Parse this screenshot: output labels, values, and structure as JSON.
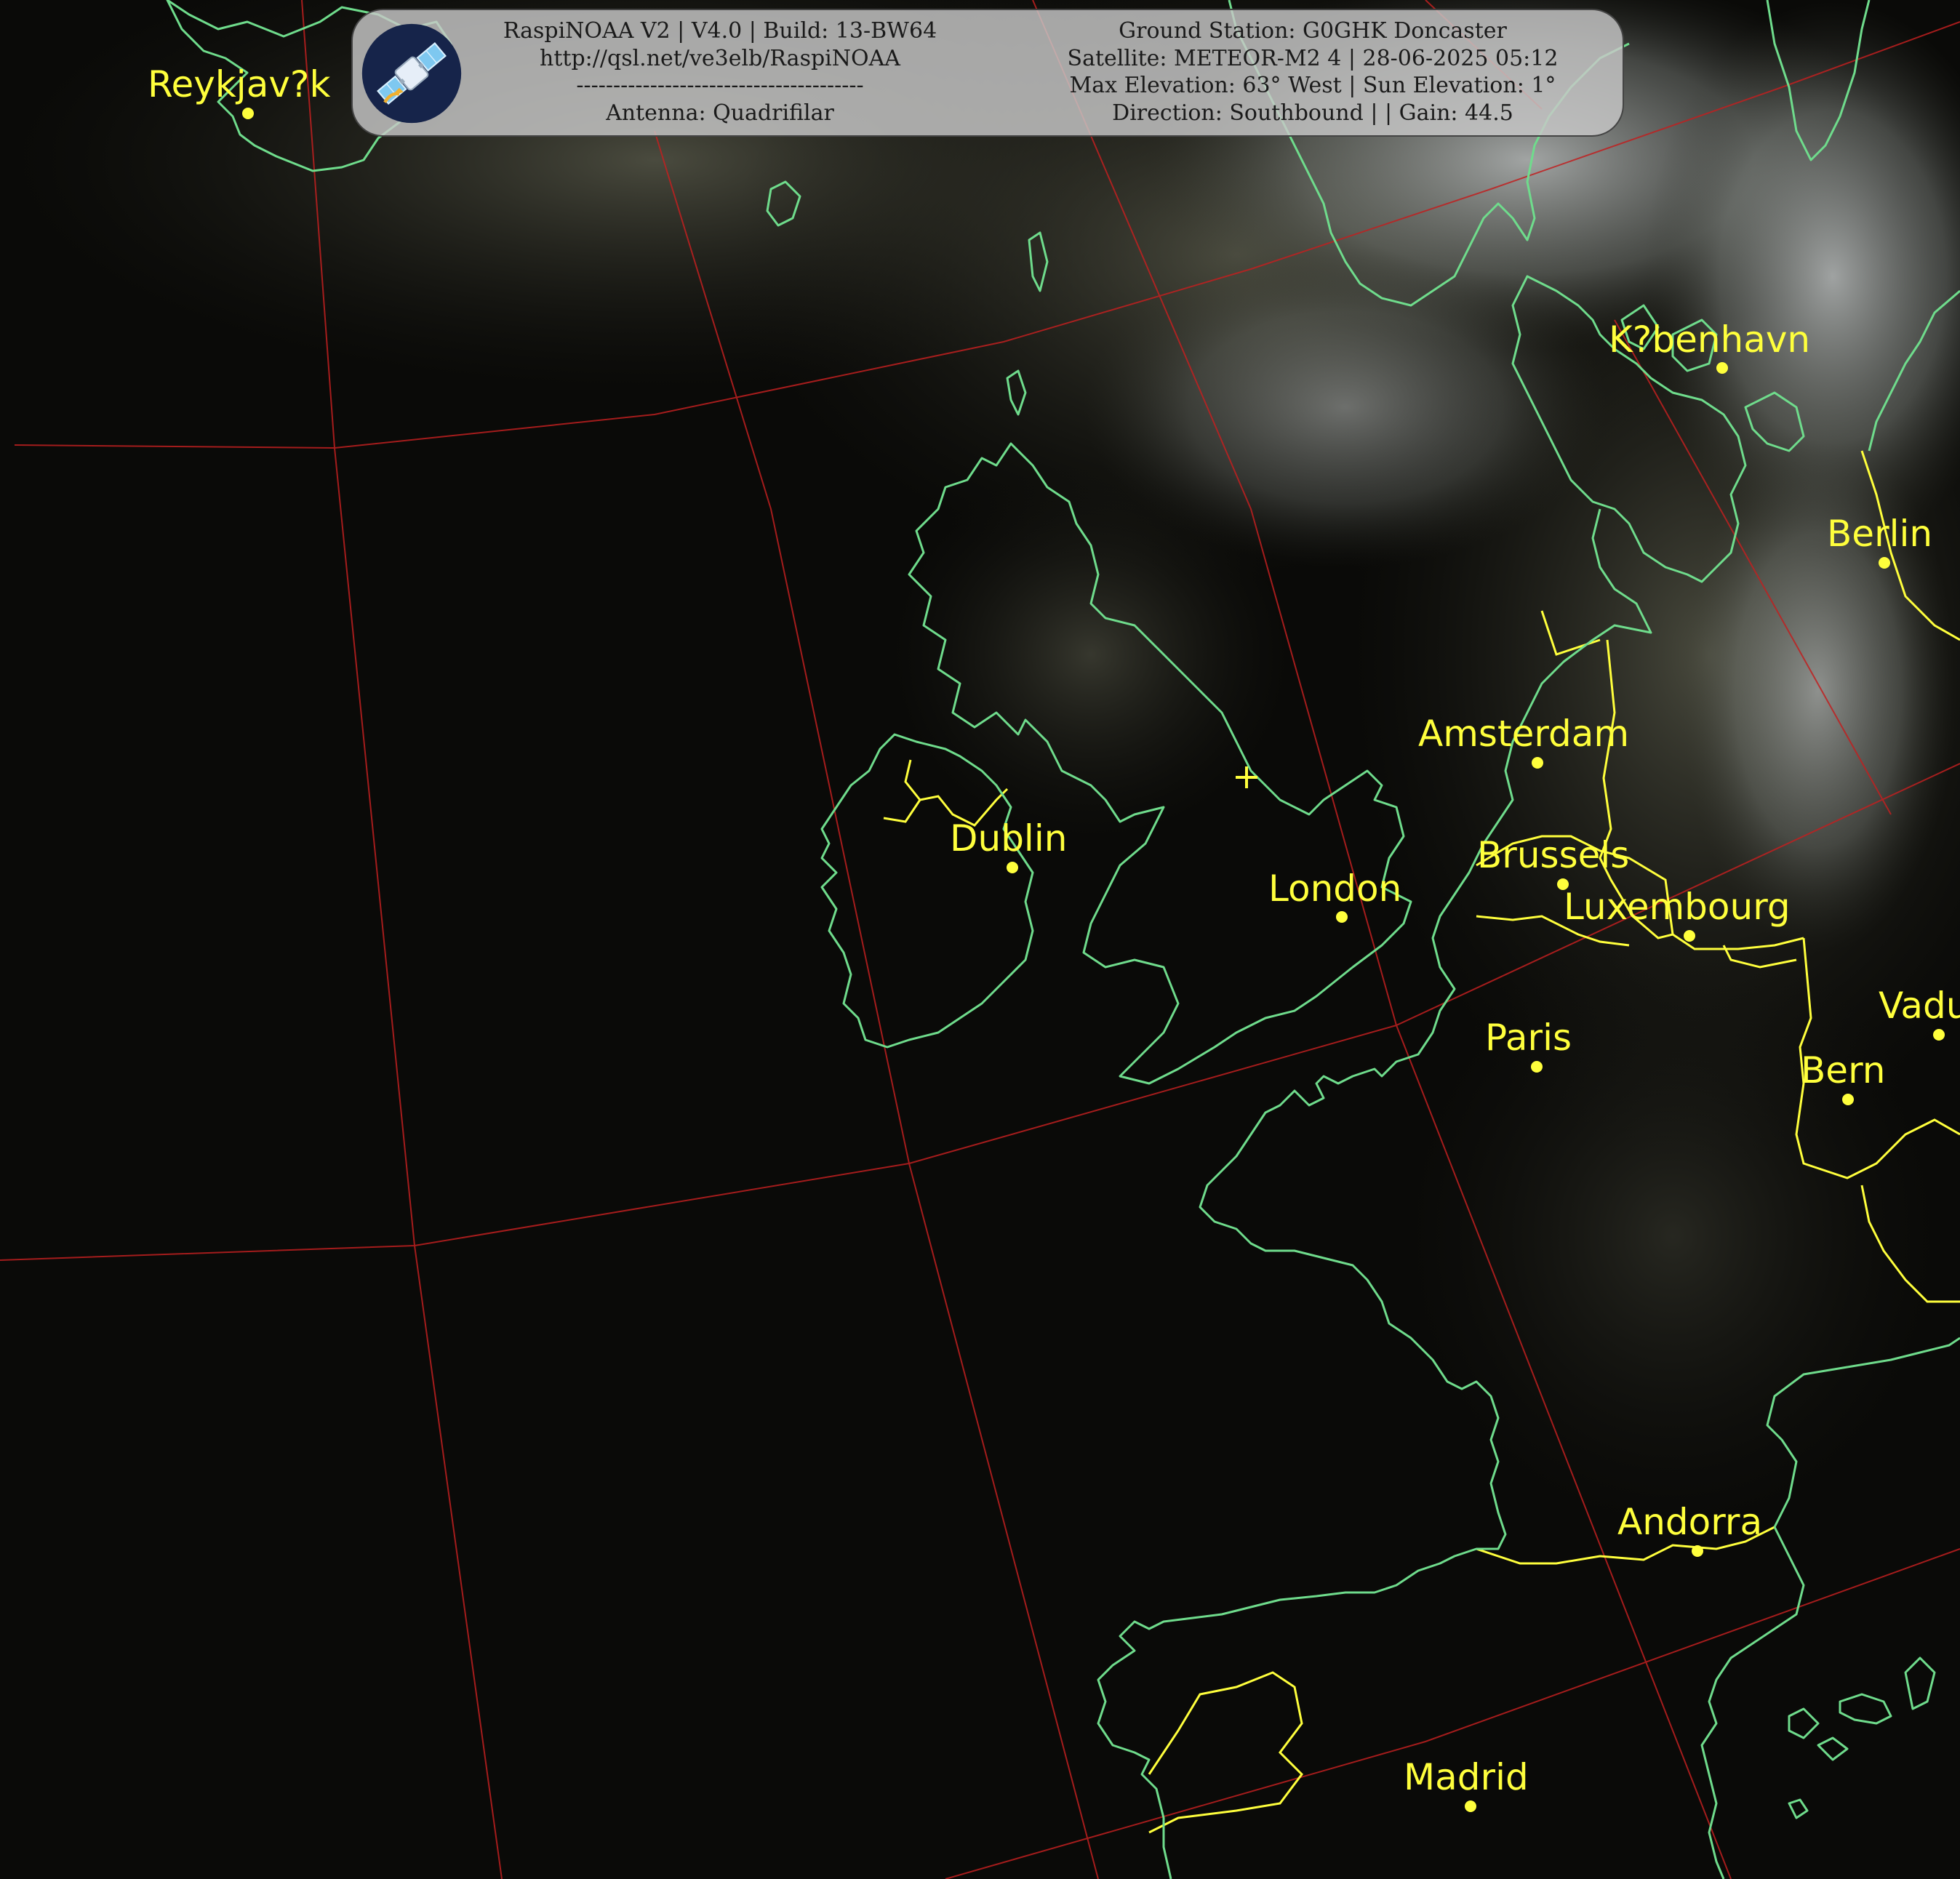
{
  "header": {
    "left_lines": [
      "RaspiNOAA V2 | V4.0 | Build: 13-BW64",
      "http://qsl.net/ve3elb/RaspiNOAA",
      "---------------------------------------",
      "Antenna: Quadrifilar"
    ],
    "right_lines": [
      "Ground Station: G0GHK Doncaster",
      "Satellite: METEOR-M2 4 | 28-06-2025 05:12",
      "Max Elevation: 63° West | Sun Elevation: 1°",
      "Direction: Southbound | | Gain: 44.5"
    ],
    "logo_icon": "satellite-icon"
  },
  "cities": [
    "Reykjav?k",
    "K?benhavn",
    "Berlin",
    "Amsterdam",
    "Dublin",
    "London",
    "Brussels",
    "Luxembourg",
    "Paris",
    "Vadu",
    "Bern",
    "Andorra",
    "Madrid"
  ],
  "colors": {
    "coastline": "#6fdc8c",
    "border": "#ffff3c",
    "graticule": "#c02020",
    "label": "#ffff3c",
    "background": "#0a0a08"
  },
  "markers": {
    "ground_station_icon": "crosshair-icon"
  }
}
